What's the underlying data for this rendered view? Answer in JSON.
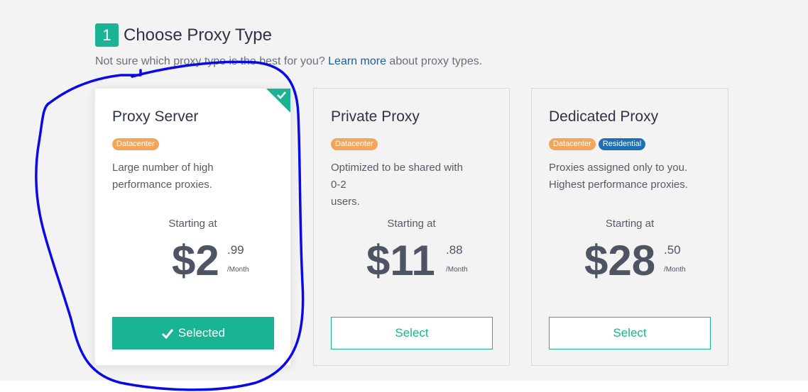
{
  "step": {
    "number": "1",
    "title": "Choose Proxy Type"
  },
  "subtitle": {
    "before": "Not sure which proxy type is the best for you? ",
    "link": "Learn more",
    "after": " about proxy types."
  },
  "cards": [
    {
      "title": "Proxy Server",
      "tags": [
        "Datacenter"
      ],
      "desc_line1": "Large number of high",
      "desc_line2": "performance proxies.",
      "starting": "Starting at",
      "price": "$2",
      "cents": ".99",
      "per": "/Month",
      "button": "Selected",
      "selected": true
    },
    {
      "title": "Private Proxy",
      "tags": [
        "Datacenter"
      ],
      "desc_line1": "Optimized to be shared with 0-2",
      "desc_line2": "users.",
      "starting": "Starting at",
      "price": "$11",
      "cents": ".88",
      "per": "/Month",
      "button": "Select",
      "selected": false
    },
    {
      "title": "Dedicated Proxy",
      "tags": [
        "Datacenter",
        "Residential"
      ],
      "desc_line1": "Proxies assigned only to you.",
      "desc_line2": "Highest performance proxies.",
      "starting": "Starting at",
      "price": "$28",
      "cents": ".50",
      "per": "/Month",
      "button": "Select",
      "selected": false
    }
  ],
  "colors": {
    "accent": "#1ab394",
    "datacenter_tag": "#f2a65a",
    "residential_tag": "#1f6fb3",
    "annotation": "#0a0ae6"
  },
  "icons": {
    "selected_corner": "check-icon",
    "selected_button": "check-icon"
  }
}
